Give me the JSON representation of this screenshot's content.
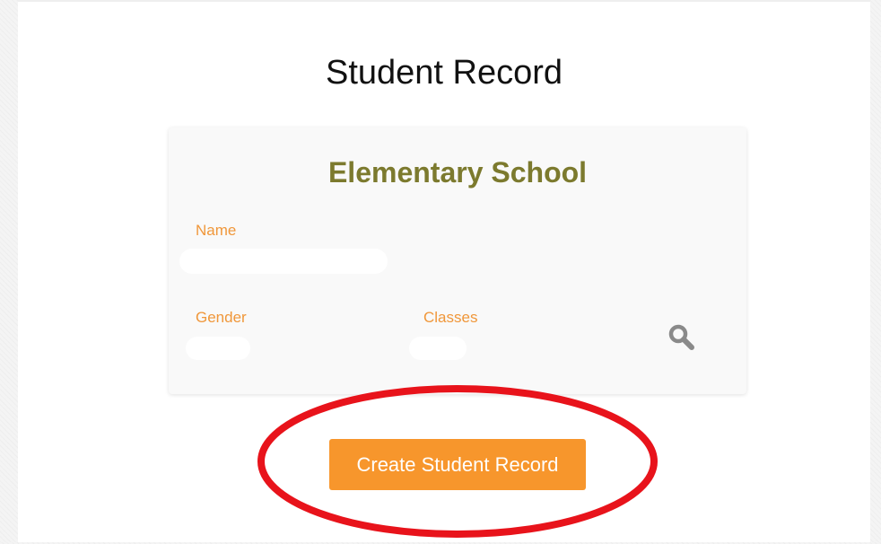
{
  "page": {
    "title": "Student Record"
  },
  "card": {
    "title": "Elementary School",
    "fields": {
      "name_label": "Name",
      "gender_label": "Gender",
      "classes_label": "Classes"
    },
    "search_icon": "search-icon"
  },
  "actions": {
    "create_label": "Create Student Record",
    "button_color": "#f7962c"
  },
  "colors": {
    "card_title": "#7c7a2e",
    "field_label": "#f0973a",
    "annotation": "#e8131b"
  }
}
